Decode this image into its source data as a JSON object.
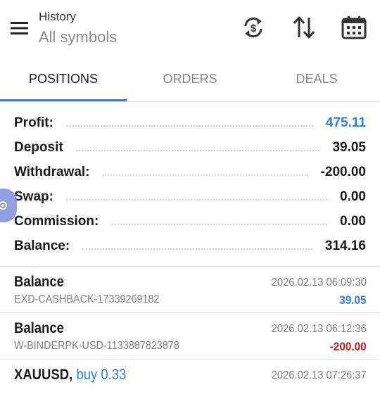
{
  "header": {
    "title": "History",
    "subtitle": "All symbols",
    "icons": [
      "menu-icon",
      "sync-currency-icon",
      "sort-icon",
      "calendar-icon"
    ]
  },
  "tabs": [
    {
      "label": "POSITIONS",
      "active": true
    },
    {
      "label": "ORDERS",
      "active": false
    },
    {
      "label": "DEALS",
      "active": false
    }
  ],
  "summary": [
    {
      "label": "Profit:",
      "value": "475.11"
    },
    {
      "label": "Deposit",
      "value": "39.05"
    },
    {
      "label": "Withdrawal:",
      "value": "-200.00"
    },
    {
      "label": "Swap:",
      "value": "0.00"
    },
    {
      "label": "Commission:",
      "value": "0.00"
    },
    {
      "label": "Balance:",
      "value": "314.16"
    }
  ],
  "deals": [
    {
      "title": "Balance",
      "comment": "EXD-CASHBACK-17339269182",
      "time": "2026.02.13 06:09:30",
      "amount": "39.05"
    },
    {
      "title": "Balance",
      "comment": "W-BINDERPK-USD-1133887823878",
      "time": "2026.02.13 06:12:36",
      "amount": "-200.00"
    },
    {
      "title": "XAUUSD,",
      "side": "buy 0.33",
      "time": "2026.02.13 07:26:37"
    }
  ],
  "colors": {
    "accent": "#2f7fd8",
    "negative": "#c61a1a"
  }
}
